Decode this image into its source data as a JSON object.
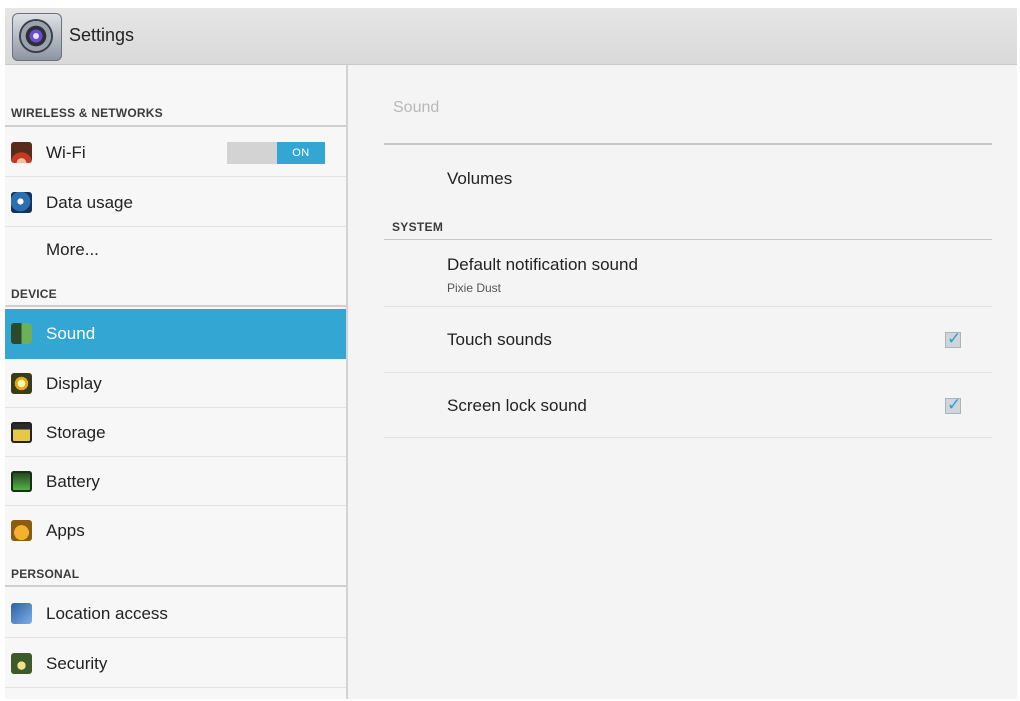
{
  "app": {
    "title": "Settings",
    "icon": "settings-gear-icon"
  },
  "sidebar": {
    "sections": [
      {
        "header": "WIRELESS & NETWORKS"
      },
      {
        "header": "DEVICE"
      },
      {
        "header": "PERSONAL"
      }
    ],
    "items": [
      {
        "label": "Wi-Fi",
        "icon": "wifi-icon",
        "toggle": "ON"
      },
      {
        "label": "Data usage",
        "icon": "data-usage-icon"
      },
      {
        "label": "More..."
      },
      {
        "label": "Sound",
        "icon": "sound-icon",
        "selected": true
      },
      {
        "label": "Display",
        "icon": "display-icon"
      },
      {
        "label": "Storage",
        "icon": "storage-icon"
      },
      {
        "label": "Battery",
        "icon": "battery-icon"
      },
      {
        "label": "Apps",
        "icon": "apps-icon"
      },
      {
        "label": "Location access",
        "icon": "location-icon"
      },
      {
        "label": "Security",
        "icon": "lock-icon"
      }
    ],
    "selected_color": "#33a6d4"
  },
  "content": {
    "title": "Sound",
    "volumes": "Volumes",
    "system_header": "SYSTEM",
    "prefs": [
      {
        "title": "Default notification sound",
        "summary": "Pixie Dust"
      },
      {
        "title": "Touch sounds",
        "checked": true
      },
      {
        "title": "Screen lock sound",
        "checked": true
      }
    ]
  }
}
